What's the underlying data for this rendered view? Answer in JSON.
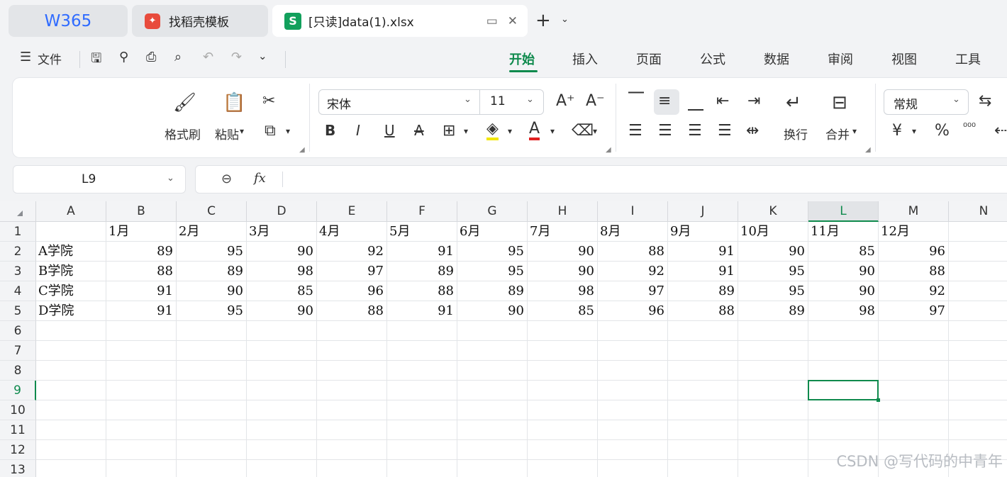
{
  "tabs": {
    "home_logo": "W365",
    "template_tab": "找稻壳模板",
    "active_doc": "[只读]data(1).xlsx",
    "active_icon": "S"
  },
  "quick_access": {
    "file_label": "文件"
  },
  "ribbon_tabs": [
    "开始",
    "插入",
    "页面",
    "公式",
    "数据",
    "审阅",
    "视图",
    "工具"
  ],
  "ribbon": {
    "format_painter": "格式刷",
    "paste": "粘贴",
    "font_name": "宋体",
    "font_size": "11",
    "wrap": "换行",
    "merge": "合并",
    "number_format": "常规",
    "currency": "¥",
    "percent": "%"
  },
  "formula_bar": {
    "cell_ref": "L9",
    "fx": "fx",
    "formula": ""
  },
  "grid": {
    "columns": [
      "A",
      "B",
      "C",
      "D",
      "E",
      "F",
      "G",
      "H",
      "I",
      "J",
      "K",
      "L",
      "M",
      "N"
    ],
    "selected_column": "L",
    "selected_row": 9,
    "row_numbers": [
      1,
      2,
      3,
      4,
      5,
      6,
      7,
      8,
      9,
      10,
      11,
      12,
      13
    ],
    "header_row": [
      "",
      "1月",
      "2月",
      "3月",
      "4月",
      "5月",
      "6月",
      "7月",
      "8月",
      "9月",
      "10月",
      "11月",
      "12月"
    ],
    "data_rows": [
      [
        "A学院",
        "89",
        "95",
        "90",
        "92",
        "91",
        "95",
        "90",
        "88",
        "91",
        "90",
        "85",
        "96"
      ],
      [
        "B学院",
        "88",
        "89",
        "98",
        "97",
        "89",
        "95",
        "90",
        "92",
        "91",
        "95",
        "90",
        "88"
      ],
      [
        "C学院",
        "91",
        "90",
        "85",
        "96",
        "88",
        "89",
        "98",
        "97",
        "89",
        "95",
        "90",
        "92"
      ],
      [
        "D学院",
        "91",
        "95",
        "90",
        "88",
        "91",
        "90",
        "85",
        "96",
        "88",
        "89",
        "98",
        "97"
      ]
    ]
  },
  "watermark": "CSDN @写代码的中青年",
  "colors": {
    "accent": "#0f8a4d",
    "w365": "#2f6bff"
  }
}
